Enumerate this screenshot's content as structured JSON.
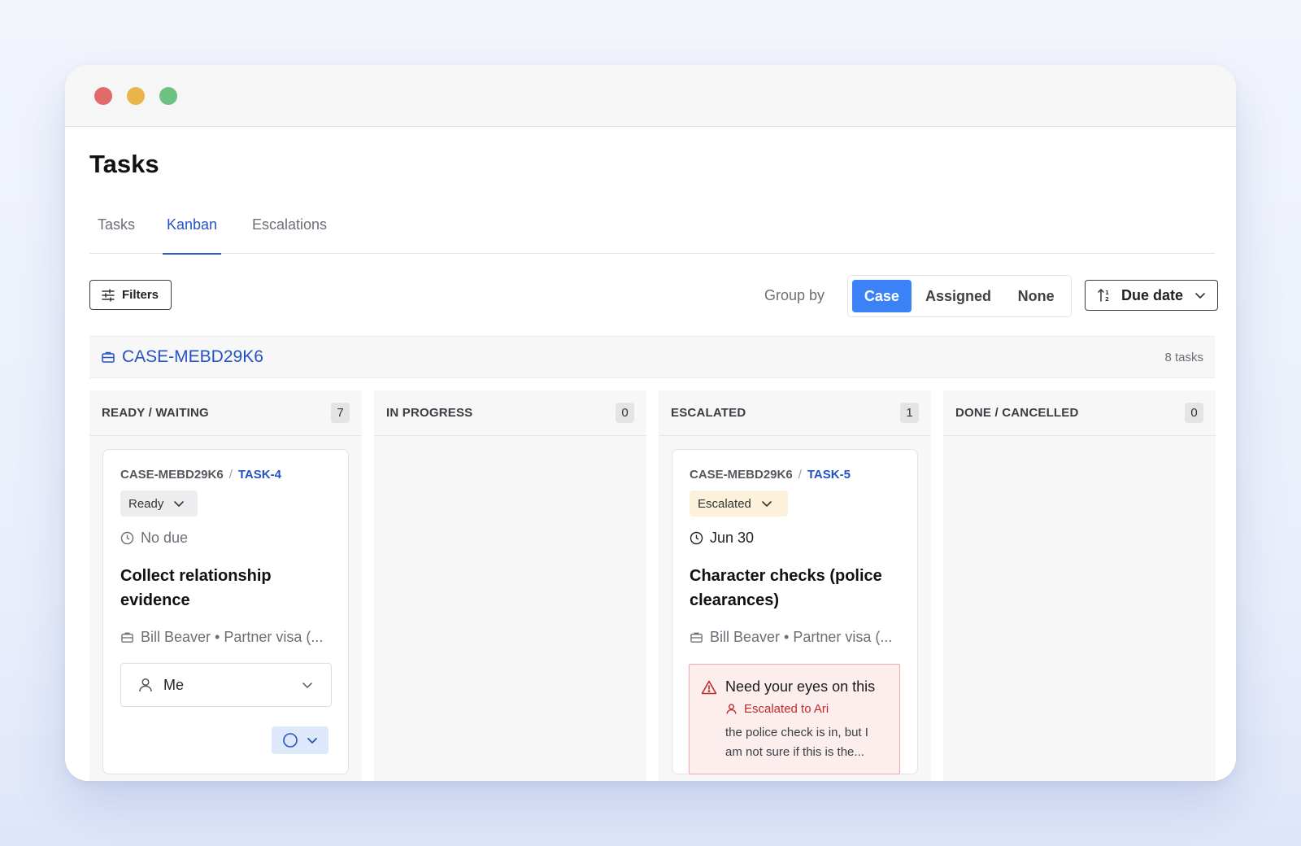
{
  "window": {
    "controls": [
      "close",
      "minimize",
      "zoom"
    ]
  },
  "page": {
    "title": "Tasks"
  },
  "tabs": [
    {
      "label": "Tasks",
      "active": false
    },
    {
      "label": "Kanban",
      "active": true
    },
    {
      "label": "Escalations",
      "active": false
    }
  ],
  "toolbar": {
    "filters_label": "Filters",
    "group_by_label": "Group by",
    "group_options": [
      "Case",
      "Assigned",
      "None"
    ],
    "group_selected": "Case",
    "sort_label": "Due date"
  },
  "case_group": {
    "case_id": "CASE-MEBD29K6",
    "task_count": "8 tasks"
  },
  "columns": [
    {
      "title": "READY / WAITING",
      "count": "7"
    },
    {
      "title": "IN PROGRESS",
      "count": "0"
    },
    {
      "title": "ESCALATED",
      "count": "1"
    },
    {
      "title": "DONE / CANCELLED",
      "count": "0"
    }
  ],
  "cards": [
    {
      "case_id": "CASE-MEBD29K6",
      "separator": "/",
      "task_id": "TASK-4",
      "status": "Ready",
      "due": "No due",
      "title": "Collect relationship evidence",
      "meta": "Bill Beaver • Partner visa (...",
      "assignee": "Me"
    },
    {
      "case_id": "CASE-MEBD29K6",
      "separator": "/",
      "task_id": "TASK-5",
      "status": "Escalated",
      "due": "Jun 30",
      "title": "Character checks (police clearances)",
      "meta": "Bill Beaver • Partner visa (...",
      "escalation": {
        "title": "Need your eyes on this",
        "escalated_to": "Escalated to Ari",
        "note": "the police check is in, but I am not sure if this is the..."
      }
    }
  ],
  "colors": {
    "accent": "#3b82f6",
    "link": "#2451c4",
    "escalated_bg": "#fcf2dc",
    "danger": "#c32828"
  }
}
